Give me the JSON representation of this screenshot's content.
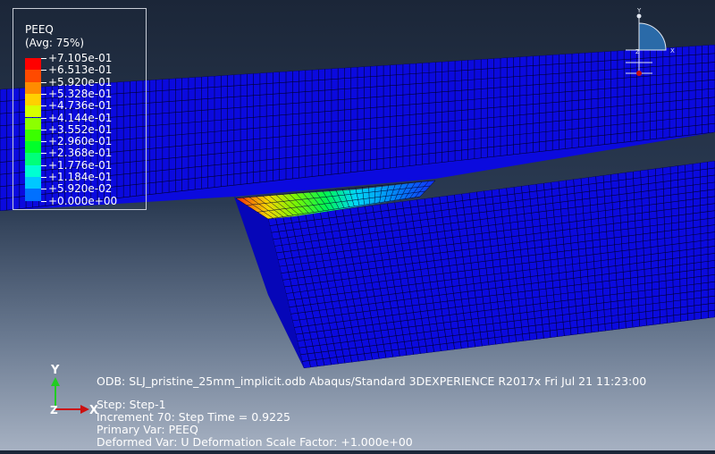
{
  "legend": {
    "title": "PEEQ",
    "subtitle": "(Avg: 75%)",
    "levels": [
      {
        "label": "+7.105e-01",
        "color": "#ff0000"
      },
      {
        "label": "+6.513e-01",
        "color": "#ff4a00"
      },
      {
        "label": "+5.920e-01",
        "color": "#ff8c00"
      },
      {
        "label": "+5.328e-01",
        "color": "#ffd000"
      },
      {
        "label": "+4.736e-01",
        "color": "#d6ff00"
      },
      {
        "label": "+4.144e-01",
        "color": "#8cff00"
      },
      {
        "label": "+3.552e-01",
        "color": "#3aff00"
      },
      {
        "label": "+2.960e-01",
        "color": "#00ff2a"
      },
      {
        "label": "+2.368e-01",
        "color": "#00ff7a"
      },
      {
        "label": "+1.776e-01",
        "color": "#00ffd2"
      },
      {
        "label": "+1.184e-01",
        "color": "#00c8ff"
      },
      {
        "label": "+5.920e-02",
        "color": "#0070ff"
      },
      {
        "label": "+0.000e+00",
        "color": "#0000ff"
      }
    ]
  },
  "info": {
    "odb_line": "ODB: SLJ_pristine_25mm_implicit.odb    Abaqus/Standard 3DEXPERIENCE R2017x    Fri Jul 21 11:23:00",
    "step_line": "Step: Step-1",
    "increment_line": "Increment      70: Step Time =    0.9225",
    "primary_var_line": "Primary Var: PEEQ",
    "deformed_var_line": "Deformed Var: U   Deformation Scale Factor: +1.000e+00"
  },
  "triad": {
    "y_label": "Y",
    "x_label": "X",
    "z_label": "Z"
  },
  "view_triad": {
    "y_label": "Y",
    "x_label": "X",
    "z_label": "Z"
  },
  "colors": {
    "mesh_fill": "#0a0ad8",
    "mesh_line": "#000033"
  }
}
